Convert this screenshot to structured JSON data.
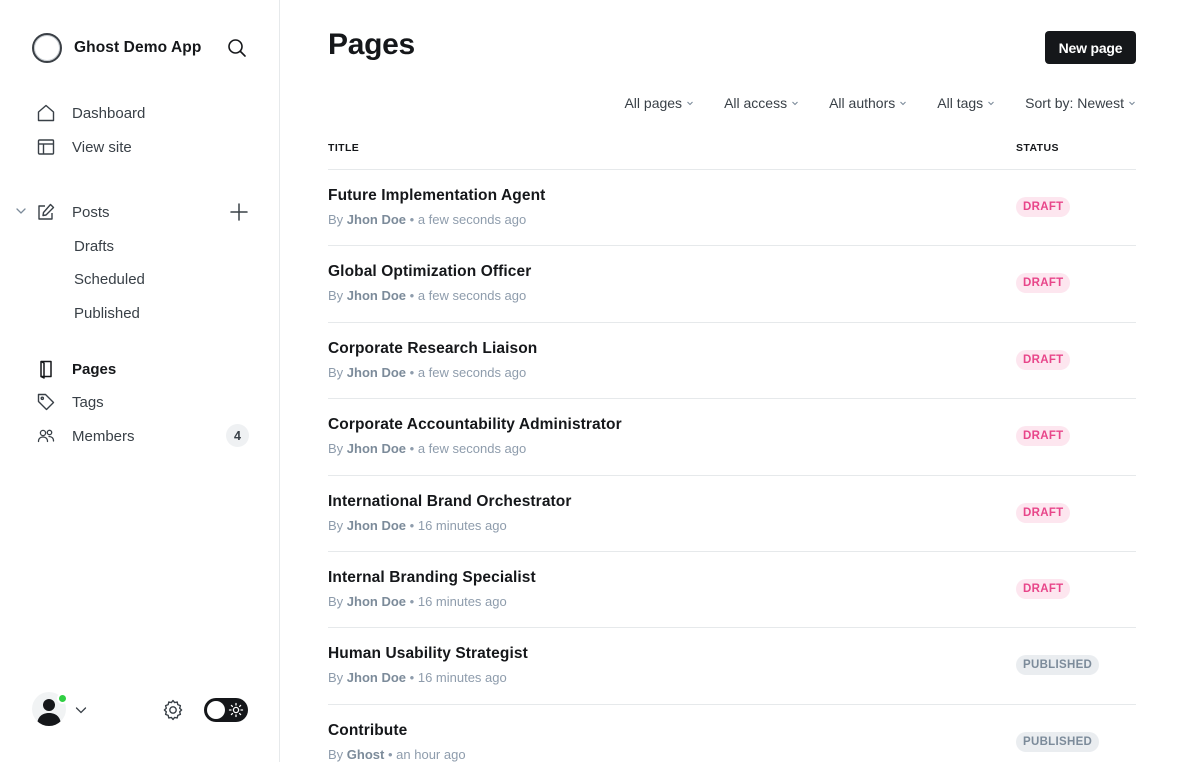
{
  "sidebar": {
    "brand_title": "Ghost Demo App",
    "nav": {
      "dashboard": "Dashboard",
      "view_site": "View site",
      "posts": "Posts",
      "drafts": "Drafts",
      "scheduled": "Scheduled",
      "published": "Published",
      "pages": "Pages",
      "tags": "Tags",
      "members": "Members",
      "members_count": "4"
    },
    "active_item": "Pages",
    "status_color": "#30cf43"
  },
  "main": {
    "title": "Pages",
    "new_button": "New page",
    "filters": [
      "All pages",
      "All access",
      "All authors",
      "All tags",
      "Sort by: Newest"
    ],
    "columns": {
      "title": "TITLE",
      "status": "STATUS"
    },
    "rows": [
      {
        "title": "Future Implementation Agent",
        "by": "By",
        "author": "Jhon Doe",
        "sep": "•",
        "time": "a few seconds ago",
        "status": "DRAFT"
      },
      {
        "title": "Global Optimization Officer",
        "by": "By",
        "author": "Jhon Doe",
        "sep": "•",
        "time": "a few seconds ago",
        "status": "DRAFT"
      },
      {
        "title": "Corporate Research Liaison",
        "by": "By",
        "author": "Jhon Doe",
        "sep": "•",
        "time": "a few seconds ago",
        "status": "DRAFT"
      },
      {
        "title": "Corporate Accountability Administrator",
        "by": "By",
        "author": "Jhon Doe",
        "sep": "•",
        "time": "a few seconds ago",
        "status": "DRAFT"
      },
      {
        "title": "International Brand Orchestrator",
        "by": "By",
        "author": "Jhon Doe",
        "sep": "•",
        "time": "16 minutes ago",
        "status": "DRAFT"
      },
      {
        "title": "Internal Branding Specialist",
        "by": "By",
        "author": "Jhon Doe",
        "sep": "•",
        "time": "16 minutes ago",
        "status": "DRAFT"
      },
      {
        "title": "Human Usability Strategist",
        "by": "By",
        "author": "Jhon Doe",
        "sep": "•",
        "time": "16 minutes ago",
        "status": "PUBLISHED"
      },
      {
        "title": "Contribute",
        "by": "By",
        "author": "Ghost",
        "sep": "•",
        "time": "an hour ago",
        "status": "PUBLISHED"
      }
    ]
  },
  "colors": {
    "accent_dark": "#15171a",
    "draft_bg": "#fde6ef",
    "draft_text": "#e8468a",
    "published_bg": "#eaedf0",
    "published_text": "#7c8b9a"
  }
}
